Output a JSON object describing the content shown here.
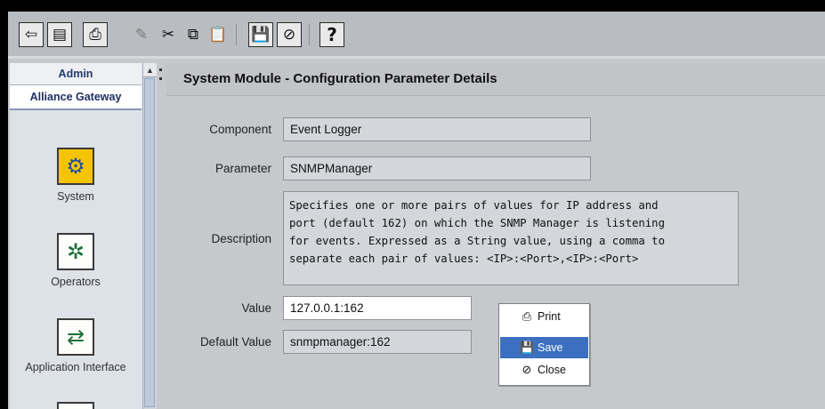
{
  "toolbar": {
    "buttons": [
      {
        "name": "logout",
        "glyph": "⇦"
      },
      {
        "name": "notes",
        "glyph": "▤"
      },
      {
        "name": "print",
        "glyph": "⎙"
      },
      {
        "name": "paint",
        "glyph": "✎"
      },
      {
        "name": "cut",
        "glyph": "✂"
      },
      {
        "name": "copy",
        "glyph": "⧉"
      },
      {
        "name": "paste",
        "glyph": "📋"
      },
      {
        "name": "save",
        "glyph": "💾"
      },
      {
        "name": "close",
        "glyph": "⊘"
      },
      {
        "name": "help",
        "glyph": "?"
      }
    ]
  },
  "nav": {
    "header": "Admin",
    "subheader": "Alliance Gateway",
    "items": [
      {
        "label": "System",
        "icon": "system-gears-icon",
        "glyph": "⚙"
      },
      {
        "label": "Operators",
        "icon": "operators-icon",
        "glyph": "✲"
      },
      {
        "label": "Application Interface",
        "icon": "application-interface-icon",
        "glyph": "⇄"
      }
    ]
  },
  "panel": {
    "title": "System Module - Configuration Parameter Details",
    "component_label": "Component",
    "component_value": "Event Logger",
    "parameter_label": "Parameter",
    "parameter_value": "SNMPManager",
    "description_label": "Description",
    "description_value": "Specifies one or more pairs of values for IP address and\nport (default 162) on which the SNMP Manager is listening\nfor events. Expressed as a String value, using a comma to\nseparate each pair of values: <IP>:<Port>,<IP>:<Port>",
    "value_label": "Value",
    "value_value": "127.0.0.1:162",
    "default_label": "Default Value",
    "default_value": "snmpmanager:162"
  },
  "menu": {
    "print": "Print",
    "save": "Save",
    "close": "Close",
    "print_icon": "printer-icon",
    "save_icon": "floppy-disk-icon",
    "close_icon": "close-icon",
    "selected": "Save",
    "selected_color": "#3c6fc0"
  }
}
